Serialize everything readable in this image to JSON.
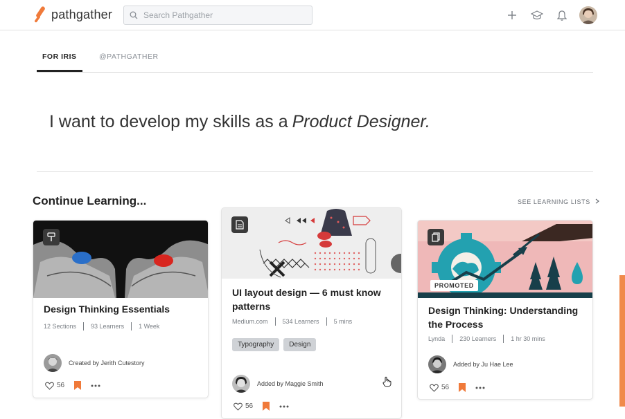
{
  "header": {
    "logo_text": "pathgather",
    "brand_color": "#f07a3a",
    "search_placeholder": "Search Pathgather",
    "icons": [
      "plus-icon",
      "graduation-cap-icon",
      "bell-icon",
      "user-avatar"
    ]
  },
  "tabs": [
    {
      "label": "FOR IRIS",
      "active": true
    },
    {
      "label": "@PATHGATHER",
      "active": false
    }
  ],
  "statement": {
    "prefix": "I want to develop my skills as a",
    "role": "Product Designer."
  },
  "continue": {
    "title": "Continue Learning...",
    "see_lists": "SEE LEARNING LISTS",
    "cards": [
      {
        "title_line1": "Design Thinking Essentials",
        "title_line2": "",
        "meta": [
          "12 Sections",
          "93 Learners",
          "1 Week"
        ],
        "tags": [],
        "byline": "Created by Jerith Cutestory",
        "likes": "56",
        "badge_icon": "paint-roller-icon"
      },
      {
        "title_line1": "UI layout design — 6 must know",
        "title_line2": "patterns",
        "meta": [
          "Medium.com",
          "534 Learners",
          "5 mins"
        ],
        "tags": [
          "Typography",
          "Design"
        ],
        "byline": "Added by Maggie Smith",
        "likes": "56",
        "badge_icon": "article-icon"
      },
      {
        "title_line1": "Design Thinking: Understanding",
        "title_line2": "the Process",
        "meta": [
          "Lynda",
          "230 Learners",
          "1 hr 30 mins"
        ],
        "tags": [],
        "byline": "Added by Ju Hae Lee",
        "likes": "56",
        "badge_icon": "copy-icon",
        "promoted": "PROMOTED"
      }
    ]
  },
  "colors": {
    "accent": "#f07a3a",
    "teal": "#23a1b0",
    "pink": "#efb8b8",
    "dark_text": "#222222"
  }
}
